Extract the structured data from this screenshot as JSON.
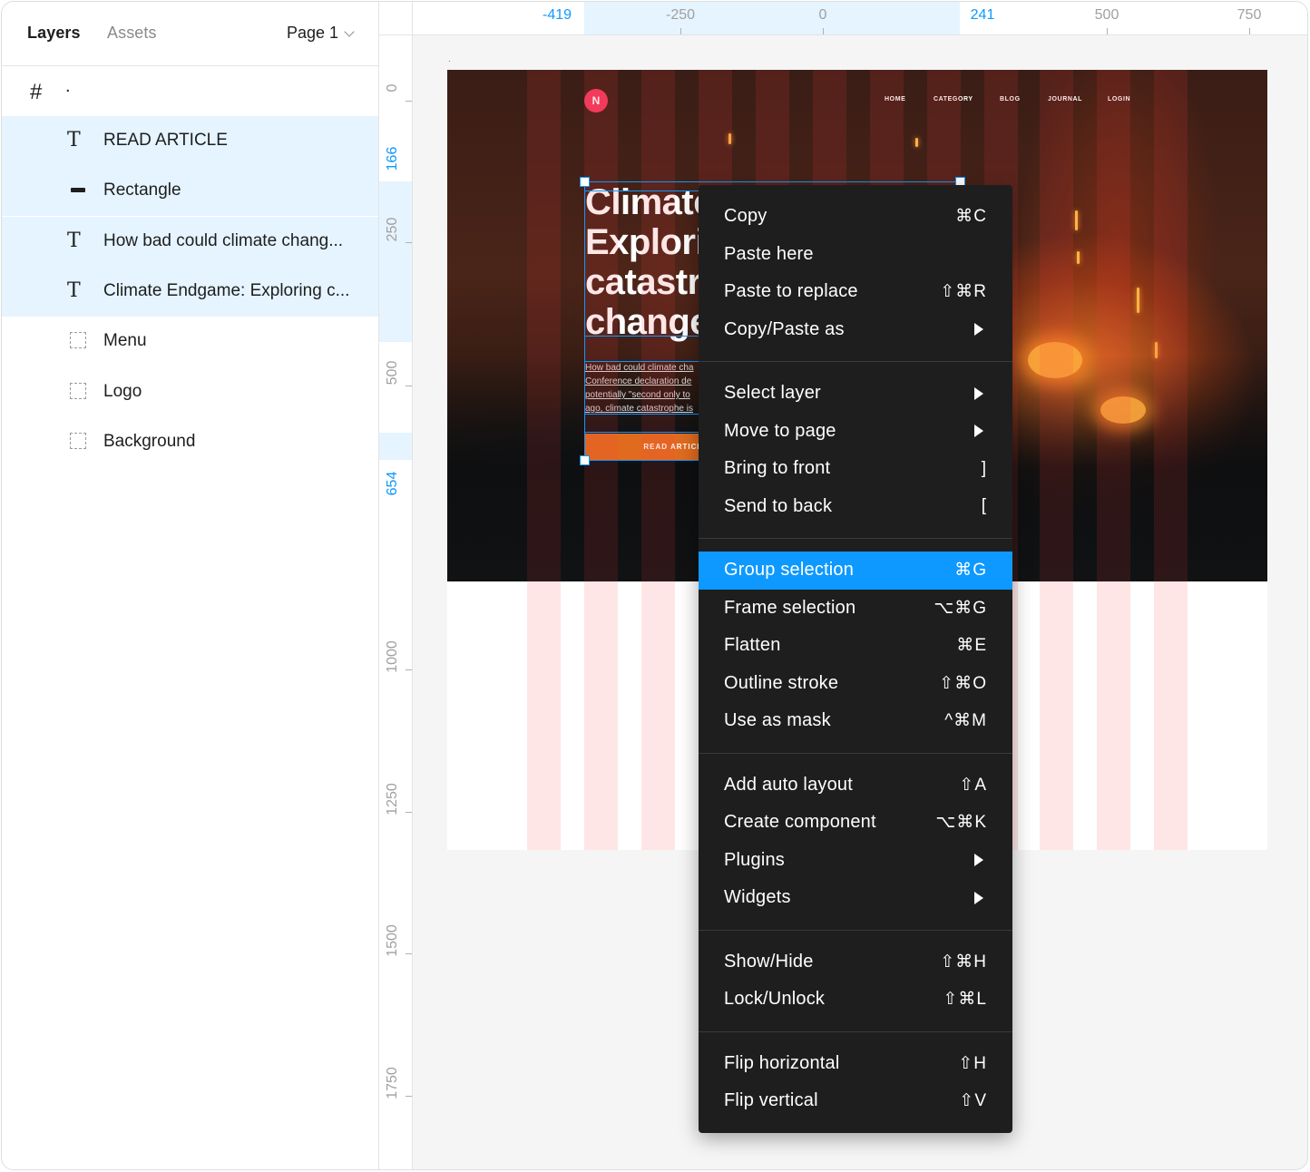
{
  "sidebar": {
    "tabs": {
      "layers": "Layers",
      "assets": "Assets"
    },
    "page_selector": "Page 1",
    "frame_layer": {
      "icon": "#",
      "name": "."
    },
    "layers": [
      {
        "name": "READ ARTICLE",
        "icon": "text-icon",
        "selected": true
      },
      {
        "name": "Rectangle",
        "icon": "rectangle-icon",
        "selected": true
      },
      {
        "name": "How bad could climate chang...",
        "icon": "text-icon",
        "selected": true
      },
      {
        "name": "Climate Endgame: Exploring c...",
        "icon": "text-icon",
        "selected": true
      },
      {
        "name": "Menu",
        "icon": "frame-dashed-icon",
        "selected": false
      },
      {
        "name": "Logo",
        "icon": "frame-dashed-icon",
        "selected": false
      },
      {
        "name": "Background",
        "icon": "frame-dashed-icon",
        "selected": false
      }
    ]
  },
  "ruler_top": {
    "labels": [
      {
        "text": "-419",
        "highlight": true
      },
      {
        "text": "-250",
        "highlight": false
      },
      {
        "text": "0",
        "highlight": false
      },
      {
        "text": "241",
        "highlight": true
      },
      {
        "text": "500",
        "highlight": false
      },
      {
        "text": "750",
        "highlight": false
      }
    ]
  },
  "ruler_left": {
    "labels": [
      {
        "text": "0",
        "highlight": false
      },
      {
        "text": "166",
        "highlight": true
      },
      {
        "text": "250",
        "highlight": false
      },
      {
        "text": "500",
        "highlight": false
      },
      {
        "text": "654",
        "highlight": true
      },
      {
        "text": "1000",
        "highlight": false
      },
      {
        "text": "1250",
        "highlight": false
      },
      {
        "text": "1500",
        "highlight": false
      },
      {
        "text": "1750",
        "highlight": false
      }
    ]
  },
  "canvas": {
    "logo_letter": "N",
    "nav": [
      "HOME",
      "CATEGORY",
      "BLOG",
      "JOURNAL",
      "LOGIN"
    ],
    "title_lines": [
      "Climate",
      "Explori",
      "catastr",
      "change"
    ],
    "body_lines": [
      "How bad could climate cha",
      "Conference declaration de",
      "potentially \"second only to",
      "ago, climate catastrophe is"
    ],
    "button_label": "READ ARTICLE"
  },
  "context_menu": {
    "groups": [
      [
        {
          "label": "Copy",
          "shortcut": "⌘C"
        },
        {
          "label": "Paste here",
          "shortcut": ""
        },
        {
          "label": "Paste to replace",
          "shortcut": "⇧⌘R"
        },
        {
          "label": "Copy/Paste as",
          "submenu": true
        }
      ],
      [
        {
          "label": "Select layer",
          "submenu": true
        },
        {
          "label": "Move to page",
          "submenu": true
        },
        {
          "label": "Bring to front",
          "shortcut": "]"
        },
        {
          "label": "Send to back",
          "shortcut": "["
        }
      ],
      [
        {
          "label": "Group selection",
          "shortcut": "⌘G",
          "highlighted": true
        },
        {
          "label": "Frame selection",
          "shortcut": "⌥⌘G"
        },
        {
          "label": "Flatten",
          "shortcut": "⌘E"
        },
        {
          "label": "Outline stroke",
          "shortcut": "⇧⌘O"
        },
        {
          "label": "Use as mask",
          "shortcut": "^⌘M"
        }
      ],
      [
        {
          "label": "Add auto layout",
          "shortcut": "⇧A"
        },
        {
          "label": "Create component",
          "shortcut": "⌥⌘K"
        },
        {
          "label": "Plugins",
          "submenu": true
        },
        {
          "label": "Widgets",
          "submenu": true
        }
      ],
      [
        {
          "label": "Show/Hide",
          "shortcut": "⇧⌘H"
        },
        {
          "label": "Lock/Unlock",
          "shortcut": "⇧⌘L"
        }
      ],
      [
        {
          "label": "Flip horizontal",
          "shortcut": "⇧H"
        },
        {
          "label": "Flip vertical",
          "shortcut": "⇧V"
        }
      ]
    ]
  },
  "colors": {
    "accent": "#0d99ff",
    "selection_bg": "#e5f4ff",
    "menu_bg": "#1e1e1e",
    "layout_grid": "#ffdede",
    "cta": "#e06b1f",
    "logo": "#f03a5f"
  }
}
